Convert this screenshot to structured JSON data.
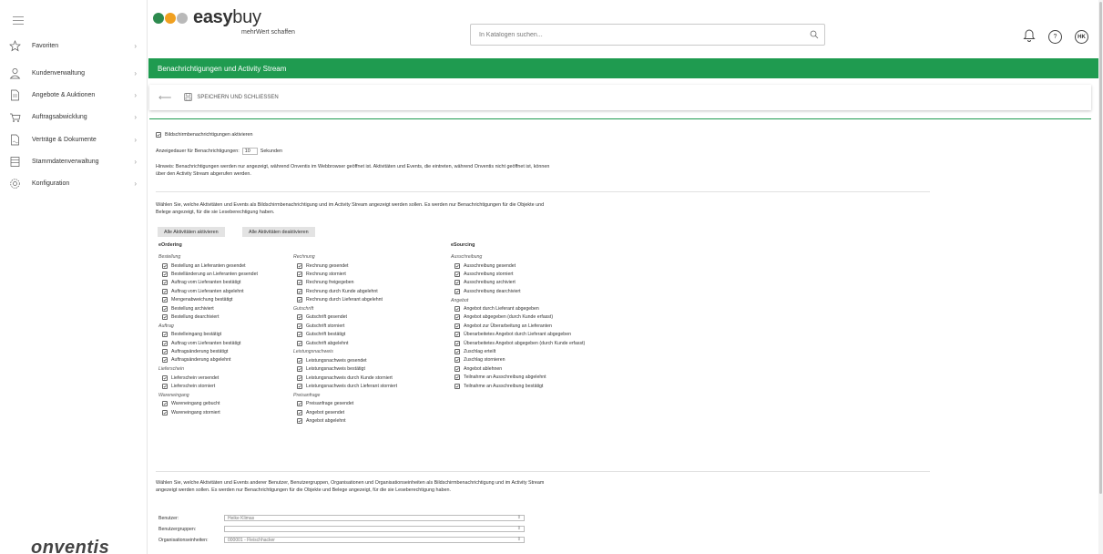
{
  "sidebar": {
    "items": [
      {
        "label": "Favoriten",
        "icon": "star-icon"
      },
      {
        "label": "Kundenverwaltung",
        "icon": "user-icon"
      },
      {
        "label": "Angebote & Auktionen",
        "icon": "document-icon"
      },
      {
        "label": "Auftragsabwicklung",
        "icon": "cart-icon"
      },
      {
        "label": "Verträge & Dokumente",
        "icon": "contract-icon"
      },
      {
        "label": "Stammdatenverwaltung",
        "icon": "database-icon"
      },
      {
        "label": "Konfiguration",
        "icon": "gear-icon"
      }
    ],
    "bottom_logo": "onventis"
  },
  "header": {
    "brand_bold": "easy",
    "brand_light": "buy",
    "tagline": "mehrWert schaffen",
    "search_placeholder": "In Katalogen suchen...",
    "help_label": "?",
    "user_initials": "HK"
  },
  "page_title": "Benachrichtigungen und Activity Stream",
  "toolbar": {
    "save_label": "SPEICHERN UND SCHLIESSEN"
  },
  "settings": {
    "screen_notifications_label": "Bildschirmbenachrichtigungen aktivieren",
    "duration_label": "Anzeigedauer für Benachrichtigungen:",
    "duration_value": "10",
    "duration_unit": "Sekunden",
    "hint": "Hinweis: Benachrichtigungen werden nur angezeigt, während Onventis im Webbrowser geöffnet ist. Aktivitäten und Events, die eintreten, während Onventis nicht geöffnet ist, können über den Activity Stream abgerufen werden."
  },
  "activities": {
    "intro": "Wählen Sie, welche Aktivitäten und Events als Bildschirmbenachrichtigung und im Activity Stream angezeigt werden sollen. Es werden nur Benachrichtigungen für die Objekte und Belege angezeigt, für die sie Leseberechtigung haben.",
    "enable_all": "Alle Aktivitäten aktivieren",
    "disable_all": "Alle Aktivitäten deaktivieren",
    "col1_title": "eOrdering",
    "col3_title": "eSourcing",
    "col1": [
      {
        "group": "Bestellung",
        "items": [
          "Bestellung an Lieferanten gesendet",
          "Bestelländerung an Lieferanten gesendet",
          "Auftrag vom Lieferanten bestätigt",
          "Auftrag vom Lieferanten abgelehnt",
          "Mengenabweichung bestätigt",
          "Bestellung archiviert",
          "Bestellung dearchiviert"
        ]
      },
      {
        "group": "Auftrag",
        "items": [
          "Bestelleingang bestätigt",
          "Auftrag vom Lieferanten bestätigt",
          "Auftragsänderung bestätigt",
          "Auftragsänderung abgelehnt"
        ]
      },
      {
        "group": "Lieferschein",
        "items": [
          "Lieferschein versendet",
          "Lieferschein storniert"
        ]
      },
      {
        "group": "Wareneingang",
        "items": [
          "Wareneingang gebucht",
          "Wareneingang storniert"
        ]
      }
    ],
    "col2": [
      {
        "group": "Rechnung",
        "items": [
          "Rechnung gesendet",
          "Rechnung storniert",
          "Rechnung freigegeben",
          "Rechnung durch Kunde abgelehnt",
          "Rechnung durch Lieferant abgelehnt"
        ]
      },
      {
        "group": "Gutschrift",
        "items": [
          "Gutschrift gesendet",
          "Gutschrift storniert",
          "Gutschrift bestätigt",
          "Gutschrift abgelehnt"
        ]
      },
      {
        "group": "Leistungsnachweis",
        "items": [
          "Leistungsnachweis gesendet",
          "Leistungsnachweis bestätigt",
          "Leistungsnachweis durch Kunde storniert",
          "Leistungsnachweis durch Lieferant storniert"
        ]
      },
      {
        "group": "Preisanfrage",
        "items": [
          "Preisanfrage gesendet",
          "Angebot gesendet",
          "Angebot abgelehnt"
        ]
      }
    ],
    "col3": [
      {
        "group": "Ausschreibung",
        "items": [
          "Ausschreibung gesendet",
          "Ausschreibung storniert",
          "Ausschreibung archiviert",
          "Ausschreibung dearchiviert"
        ]
      },
      {
        "group": "Angebot",
        "items": [
          "Angebot durch Lieferant abgegeben",
          "Angebot abgegeben (durch Kunde erfasst)",
          "Angebot zur Überarbeitung an Lieferanten",
          "Überarbeitetes Angebot durch Lieferant abgegeben",
          "Überarbeitetes Angebot abgegeben (durch Kunde erfasst)",
          "Zuschlag erteilt",
          "Zuschlag stornieren",
          "Angebot ablehnen",
          "Teilnahme an Ausschreibung abgelehnt",
          "Teilnahme an Ausschreibung bestätigt"
        ]
      }
    ]
  },
  "others": {
    "intro": "Wählen Sie, welche Aktivitäten und Events anderer Benutzer, Benutzergruppen, Organisationen und Organisationseinheiten als Bildschirmbenachrichtigung und im Activity Stream angezeigt werden sollen. Es werden nur Benachrichtigungen für die Objekte und Belege angezeigt, für die sie Leseberechtigung haben.",
    "fields": [
      {
        "label": "Benutzer:",
        "value": "Heike Klimas"
      },
      {
        "label": "Benutzergruppen:",
        "value": ""
      },
      {
        "label": "Organisationseinheiten:",
        "value": "000001 - Fleischhacker"
      }
    ]
  }
}
